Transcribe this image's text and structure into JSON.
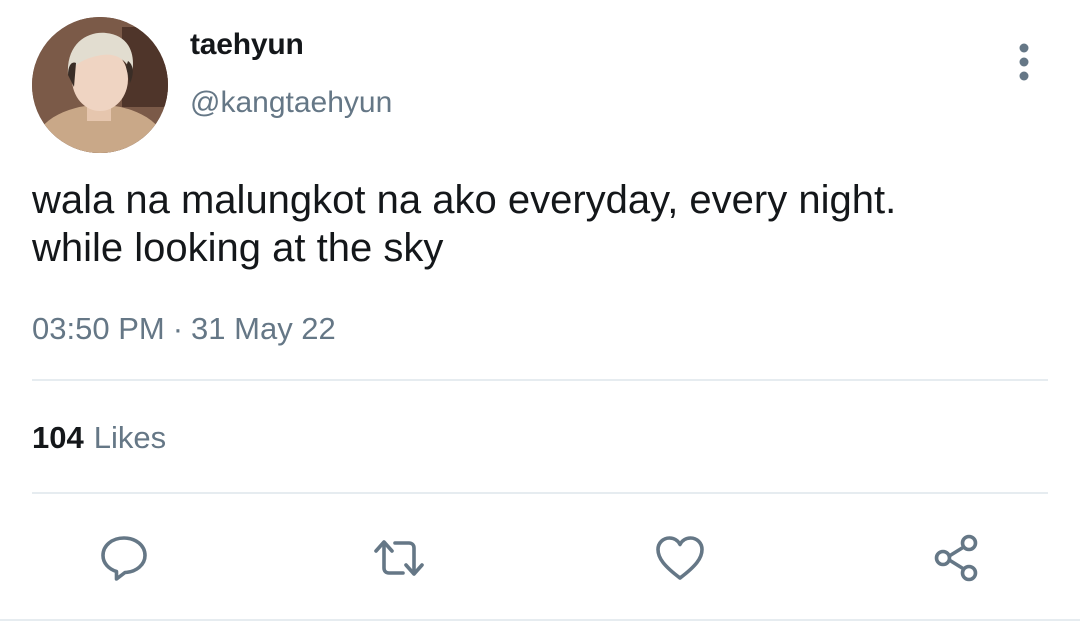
{
  "user": {
    "display_name": "taehyun",
    "handle": "@kangtaehyun",
    "avatar_icon": "profile-photo"
  },
  "tweet": {
    "text_lines": [
      "wala na malungkot na ako everyday, every night.",
      "while looking at the sky"
    ],
    "time": "03:50 PM",
    "separator": "·",
    "date": "31 May 22"
  },
  "stats": {
    "likes_count": "104",
    "likes_label": "Likes"
  },
  "actions": {
    "reply_icon": "reply-icon",
    "retweet_icon": "retweet-icon",
    "like_icon": "heart-icon",
    "share_icon": "share-icon",
    "more_icon": "more-vertical-icon"
  },
  "colors": {
    "primary_text": "#14171a",
    "secondary_text": "#657786",
    "divider": "#e6ecf0",
    "icon": "#657786"
  }
}
